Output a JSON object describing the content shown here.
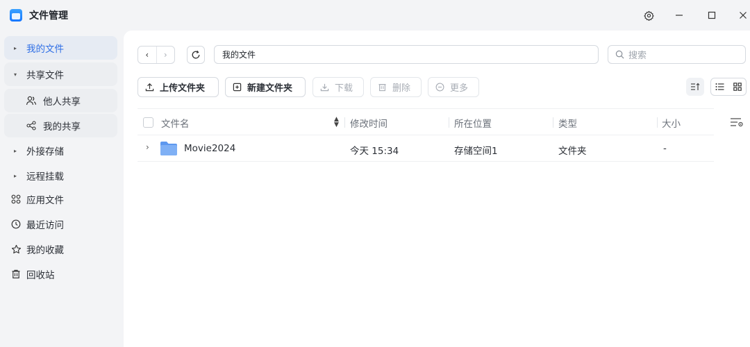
{
  "app": {
    "title": "文件管理"
  },
  "sidebar": {
    "items": [
      {
        "label": "我的文件"
      },
      {
        "label": "共享文件"
      },
      {
        "label": "他人共享"
      },
      {
        "label": "我的共享"
      },
      {
        "label": "外接存储"
      },
      {
        "label": "远程挂载"
      },
      {
        "label": "应用文件"
      },
      {
        "label": "最近访问"
      },
      {
        "label": "我的收藏"
      },
      {
        "label": "回收站"
      }
    ]
  },
  "address": {
    "path": "我的文件",
    "search_placeholder": "搜索"
  },
  "toolbar": {
    "upload": "上传文件夹",
    "new_folder": "新建文件夹",
    "download": "下载",
    "delete": "删除",
    "more": "更多"
  },
  "table": {
    "columns": [
      "文件名",
      "修改时间",
      "所在位置",
      "类型",
      "大小"
    ],
    "rows": [
      {
        "name": "Movie2024",
        "modified": "今天 15:34",
        "location": "存储空间1",
        "type": "文件夹",
        "size": "-"
      }
    ]
  },
  "colors": {
    "accent": "#2f6fe6",
    "folder": "#7fb0f5",
    "folder_dark": "#5d98ef"
  }
}
